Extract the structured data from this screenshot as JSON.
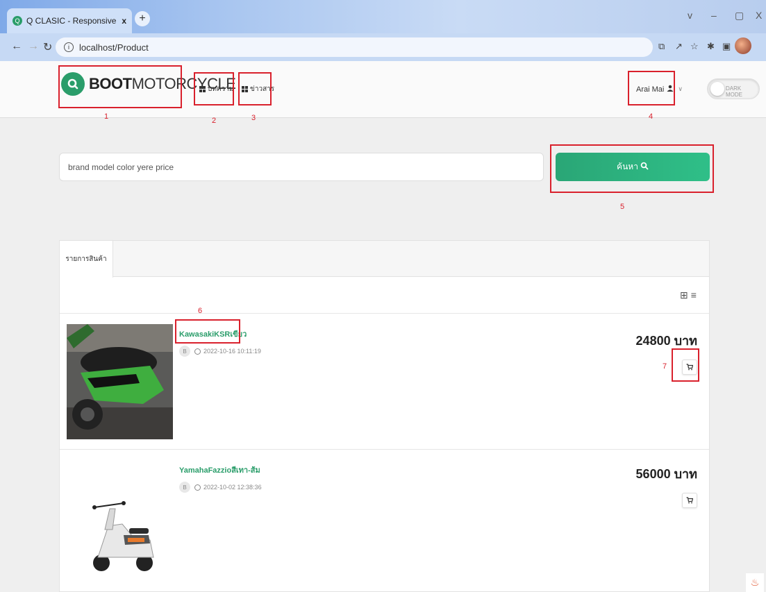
{
  "browser": {
    "tab_title": "Q CLASIC - Responsive Cl",
    "tab_close": "x",
    "new_tab": "+",
    "url": "localhost/Product",
    "window_controls": [
      "v",
      "–",
      "▢",
      "X"
    ]
  },
  "header": {
    "logo_bold": "BOOT",
    "logo_thin": "MOTORCYCLE",
    "nav": [
      {
        "label": "บทความ"
      },
      {
        "label": "ข่าวสาร"
      }
    ],
    "user_name": "Arai Mai",
    "dark_mode_label": "DARK MODE"
  },
  "search": {
    "placeholder": "brand model color yere price",
    "button_label": "ค้นหา"
  },
  "products": {
    "tab_label": "รายการสินค้า",
    "items": [
      {
        "name": "KawasakiKSRเขียว",
        "seller_initial": "B",
        "date": "2022-10-16 10:11:19",
        "price": "24800 บาท"
      },
      {
        "name": "YamahaFazzioสีเทา-ส้ม",
        "seller_initial": "B",
        "date": "2022-10-02 12:38:36",
        "price": "56000 บาท"
      }
    ]
  },
  "annotations": [
    "1",
    "2",
    "3",
    "4",
    "5",
    "6",
    "7"
  ],
  "colors": {
    "brand_green": "#2a9d6a",
    "annotation_red": "#d9202c"
  }
}
